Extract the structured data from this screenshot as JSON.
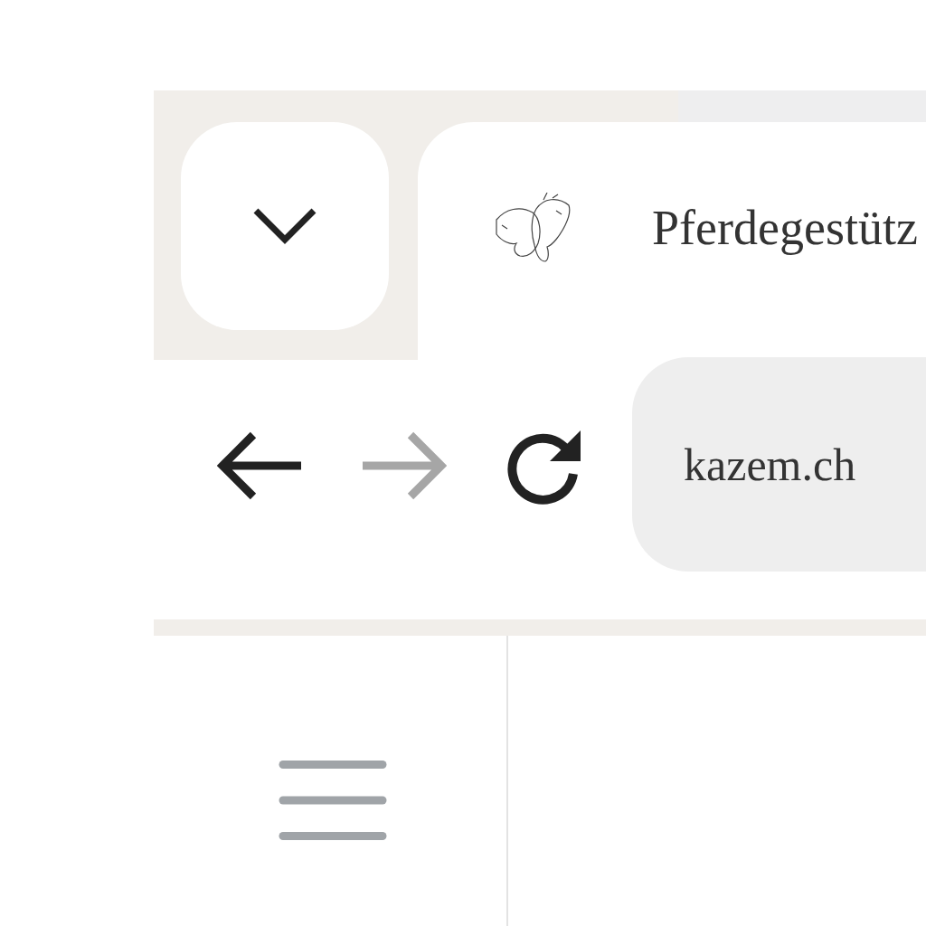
{
  "tab_strip": {
    "menu_button": {
      "expanded": false
    }
  },
  "tab": {
    "title": "Pferdegestütz",
    "selected": true
  },
  "toolbar": {
    "buttons": [
      {
        "kind": "back",
        "disabled": false
      },
      {
        "kind": "forward",
        "disabled": true
      },
      {
        "kind": "reload",
        "disabled": false
      }
    ]
  },
  "address_bar": {
    "value": "kazem.ch"
  }
}
